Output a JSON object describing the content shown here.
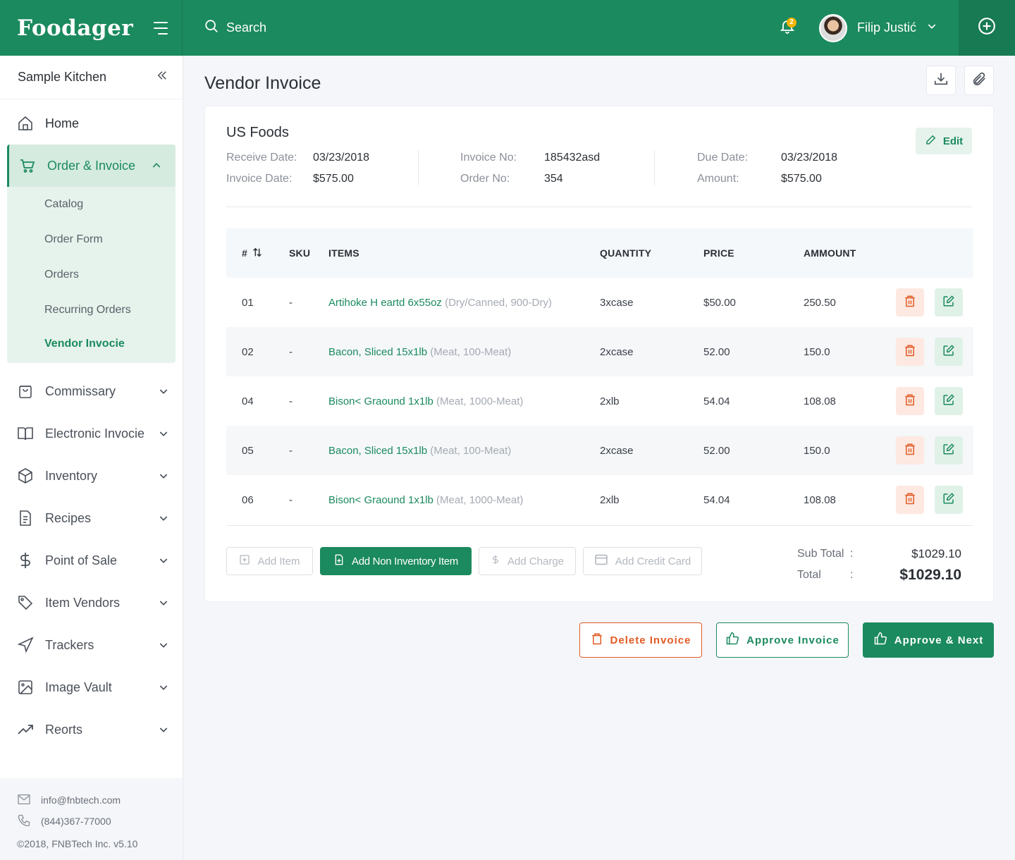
{
  "brand": {
    "name": "Foodager",
    "accent": "#1b8a5e"
  },
  "topbar": {
    "search_placeholder": "Search",
    "notification_count": "2",
    "user_name": "Filip Justić"
  },
  "sidebar": {
    "kitchen": "Sample Kitchen",
    "home": "Home",
    "group_label": "Order & Invoice",
    "sub_items": [
      "Catalog",
      "Order Form",
      "Orders",
      "Recurring Orders",
      "Vendor Invocie"
    ],
    "items": [
      "Commissary",
      "Electronic Invocie",
      "Inventory",
      "Recipes",
      "Point of Sale",
      "Item Vendors",
      "Trackers",
      "Image Vault",
      "Reorts"
    ],
    "footer": {
      "email": "info@fnbtech.com",
      "phone": "(844)367-77000",
      "copyright": "©2018, FNBTech Inc. v5.10"
    }
  },
  "page": {
    "title": "Vendor Invoice"
  },
  "invoice": {
    "vendor": "US Foods",
    "edit_label": "Edit",
    "receive_date_label": "Receive Date:",
    "receive_date": "03/23/2018",
    "invoice_date_label": "Invoice Date:",
    "invoice_date": "$575.00",
    "invoice_no_label": "Invoice No:",
    "invoice_no": "185432asd",
    "order_no_label": "Order No:",
    "order_no": "354",
    "due_date_label": "Due Date:",
    "due_date": "03/23/2018",
    "amount_label": "Amount:",
    "amount": "$575.00"
  },
  "table": {
    "headers": [
      "#",
      "SKU",
      "ITEMS",
      "QUANTITY",
      "PRICE",
      "AMMOUNT"
    ],
    "rows": [
      {
        "num": "01",
        "sku": "-",
        "item": "Artihoke H eartd 6x55oz",
        "meta": "(Dry/Canned, 900-Dry)",
        "qty": "3xcase",
        "price": "$50.00",
        "amount": "250.50"
      },
      {
        "num": "02",
        "sku": "-",
        "item": "Bacon, Sliced 15x1lb",
        "meta": "(Meat, 100-Meat)",
        "qty": "2xcase",
        "price": "52.00",
        "amount": "150.0"
      },
      {
        "num": "04",
        "sku": "-",
        "item": "Bison< Graound 1x1lb",
        "meta": "(Meat, 1000-Meat)",
        "qty": "2xlb",
        "price": "54.04",
        "amount": "108.08"
      },
      {
        "num": "05",
        "sku": "-",
        "item": "Bacon, Sliced 15x1lb",
        "meta": "(Meat, 100-Meat)",
        "qty": "2xcase",
        "price": "52.00",
        "amount": "150.0"
      },
      {
        "num": "06",
        "sku": "-",
        "item": "Bison< Graound 1x1lb",
        "meta": "(Meat, 1000-Meat)",
        "qty": "2xlb",
        "price": "54.04",
        "amount": "108.08"
      }
    ]
  },
  "actions": {
    "add_item": "Add Item",
    "add_non_inventory": "Add Non Inventory Item",
    "add_charge": "Add Charge",
    "add_credit_card": "Add Credit Card"
  },
  "totals": {
    "subtotal_label": "Sub Total",
    "subtotal": "$1029.10",
    "total_label": "Total",
    "total": "$1029.10",
    "colon": ":"
  },
  "footer_actions": {
    "delete": "Delete Invoice",
    "approve": "Approve Invoice",
    "approve_next": "Approve & Next"
  },
  "colors": {
    "primary": "#1b8a5e",
    "danger": "#e25a25",
    "warning_badge": "#f5b400"
  }
}
